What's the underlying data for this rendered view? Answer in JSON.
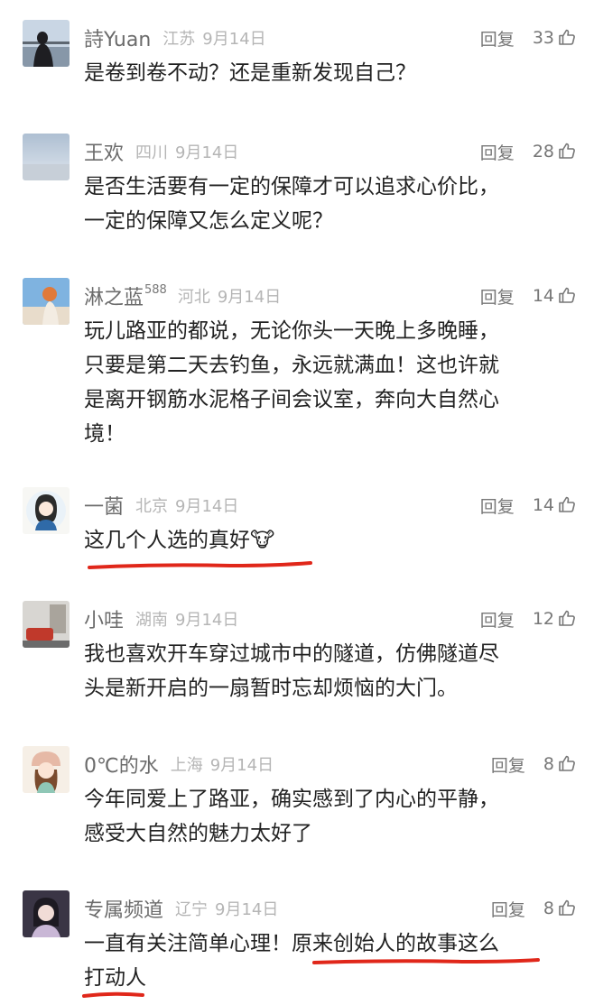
{
  "comments": [
    {
      "name": "詩Yuan",
      "superscript": "",
      "region": "江苏",
      "date": "9月14日",
      "reply_label": "回复",
      "likes": "33",
      "text": "是卷到卷不动？还是重新发现自己？"
    },
    {
      "name": "王欢",
      "superscript": "",
      "region": "四川",
      "date": "9月14日",
      "reply_label": "回复",
      "likes": "28",
      "text": "是否生活要有一定的保障才可以追求心价比，\n一定的保障又怎么定义呢？"
    },
    {
      "name": "淋之蓝",
      "superscript": "588",
      "region": "河北",
      "date": "9月14日",
      "reply_label": "回复",
      "likes": "14",
      "text": "玩儿路亚的都说，无论你头一天晚上多晚睡，\n只要是第二天去钓鱼，永远就满血！这也许就\n是离开钢筋水泥格子间会议室，奔向大自然心\n境！"
    },
    {
      "name": "一菌",
      "superscript": "",
      "region": "北京",
      "date": "9月14日",
      "reply_label": "回复",
      "likes": "14",
      "text": "这几个人选的真好🐮"
    },
    {
      "name": "小哇",
      "superscript": "",
      "region": "湖南",
      "date": "9月14日",
      "reply_label": "回复",
      "likes": "12",
      "text": "我也喜欢开车穿过城市中的隧道，仿佛隧道尽\n头是新开启的一扇暂时忘却烦恼的大门。"
    },
    {
      "name": "0℃的水",
      "superscript": "",
      "region": "上海",
      "date": "9月14日",
      "reply_label": "回复",
      "likes": "8",
      "text": "今年同爱上了路亚，确实感到了内心的平静，\n感受大自然的魅力太好了"
    },
    {
      "name": "专属频道",
      "superscript": "",
      "region": "辽宁",
      "date": "9月14日",
      "reply_label": "回复",
      "likes": "8",
      "text": "一直有关注简单心理！原来创始人的故事这么\n打动人"
    }
  ],
  "colors": {
    "annotation_red": "#e0271a"
  }
}
